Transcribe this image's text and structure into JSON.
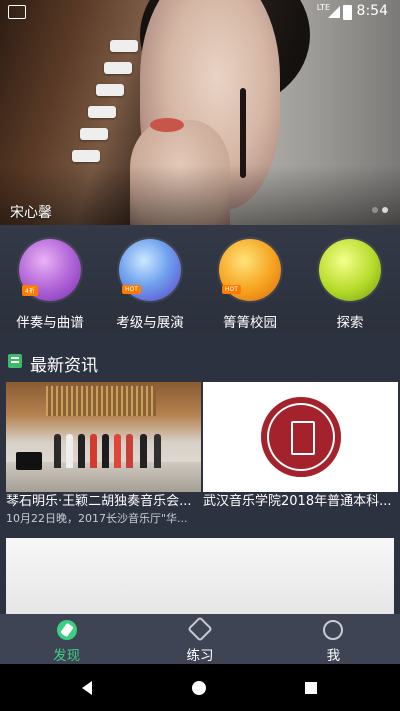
{
  "status_bar": {
    "network": "LTE",
    "time": "8:54"
  },
  "banner": {
    "caption": "宋心馨",
    "page_indicator": {
      "count": 2,
      "active_index": 1
    }
  },
  "categories": [
    {
      "label": "伴奏与曲谱",
      "badge": "4折"
    },
    {
      "label": "考级与展演",
      "badge": "HOT"
    },
    {
      "label": "箐箐校园",
      "badge": "HOT"
    },
    {
      "label": "探索",
      "badge": ""
    }
  ],
  "news": {
    "section_title": "最新资讯",
    "cards": [
      {
        "title": "琴石明乐·王颖二胡独奏音乐会...",
        "description": "10月22日晚，2017长沙音乐厅\"华..."
      },
      {
        "title": "武汉音乐学院2018年普通本科...",
        "description": ""
      }
    ]
  },
  "tabs": [
    {
      "label": "发现",
      "icon": "compass-icon",
      "active": true
    },
    {
      "label": "练习",
      "icon": "violin-icon",
      "active": false
    },
    {
      "label": "我",
      "icon": "profile-icon",
      "active": false
    }
  ],
  "colors": {
    "accent": "#3ccf83",
    "tabbar": "#3e4453",
    "background": "#2c3240"
  }
}
